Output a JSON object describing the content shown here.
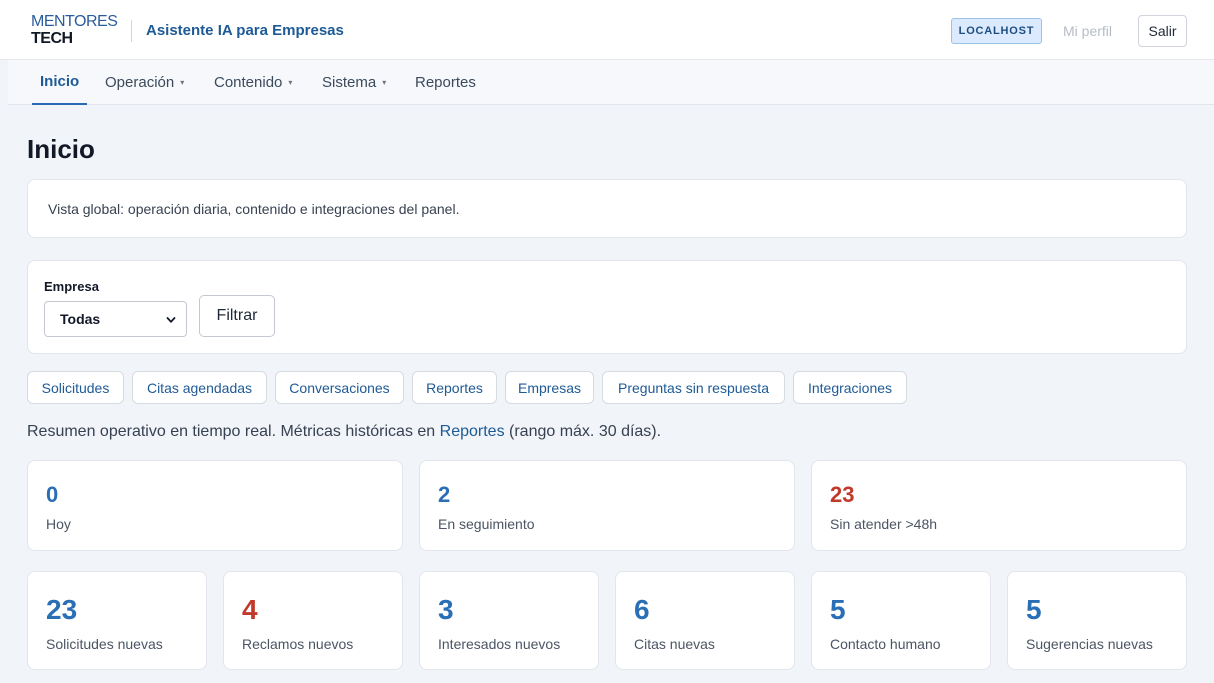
{
  "header": {
    "logo_line1": "MENTORES",
    "logo_line2": "TECH",
    "app_title": "Asistente IA para Empresas",
    "env_badge": "LOCALHOST",
    "profile_label": "Mi perfil",
    "logout_label": "Salir"
  },
  "nav": {
    "items": [
      {
        "label": "Inicio",
        "active": true,
        "has_dropdown": false
      },
      {
        "label": "Operación",
        "active": false,
        "has_dropdown": true
      },
      {
        "label": "Contenido",
        "active": false,
        "has_dropdown": true
      },
      {
        "label": "Sistema",
        "active": false,
        "has_dropdown": true
      },
      {
        "label": "Reportes",
        "active": false,
        "has_dropdown": false
      }
    ],
    "caret_glyph": "▾"
  },
  "page": {
    "title": "Inicio",
    "intro": "Vista global: operación diaria, contenido e integraciones del panel."
  },
  "filter": {
    "label": "Empresa",
    "selected": "Todas",
    "button_label": "Filtrar"
  },
  "quick_links": [
    "Solicitudes",
    "Citas agendadas",
    "Conversaciones",
    "Reportes",
    "Empresas",
    "Preguntas sin respuesta",
    "Integraciones"
  ],
  "summary": {
    "text_before": "Resumen operativo en tiempo real. Métricas históricas en ",
    "link": "Reportes",
    "text_after": " (rango máx. 30 días)."
  },
  "metrics_top": [
    {
      "value": "0",
      "label": "Hoy",
      "alert": false
    },
    {
      "value": "2",
      "label": "En seguimiento",
      "alert": false
    },
    {
      "value": "23",
      "label": "Sin atender >48h",
      "alert": true
    }
  ],
  "metrics_bottom": [
    {
      "value": "23",
      "label": "Solicitudes nuevas",
      "alert": false
    },
    {
      "value": "4",
      "label": "Reclamos nuevos",
      "alert": true
    },
    {
      "value": "3",
      "label": "Interesados nuevos",
      "alert": false
    },
    {
      "value": "6",
      "label": "Citas nuevas",
      "alert": false
    },
    {
      "value": "5",
      "label": "Contacto humano",
      "alert": false
    },
    {
      "value": "5",
      "label": "Sugerencias nuevas",
      "alert": false
    }
  ],
  "colors": {
    "accent": "#1e5a96",
    "metric_value": "#2a6eb5",
    "metric_alert": "#c0392b",
    "badge_bg": "#dbeafe"
  },
  "icons": {
    "select_chevron": "chevron-down-icon"
  }
}
